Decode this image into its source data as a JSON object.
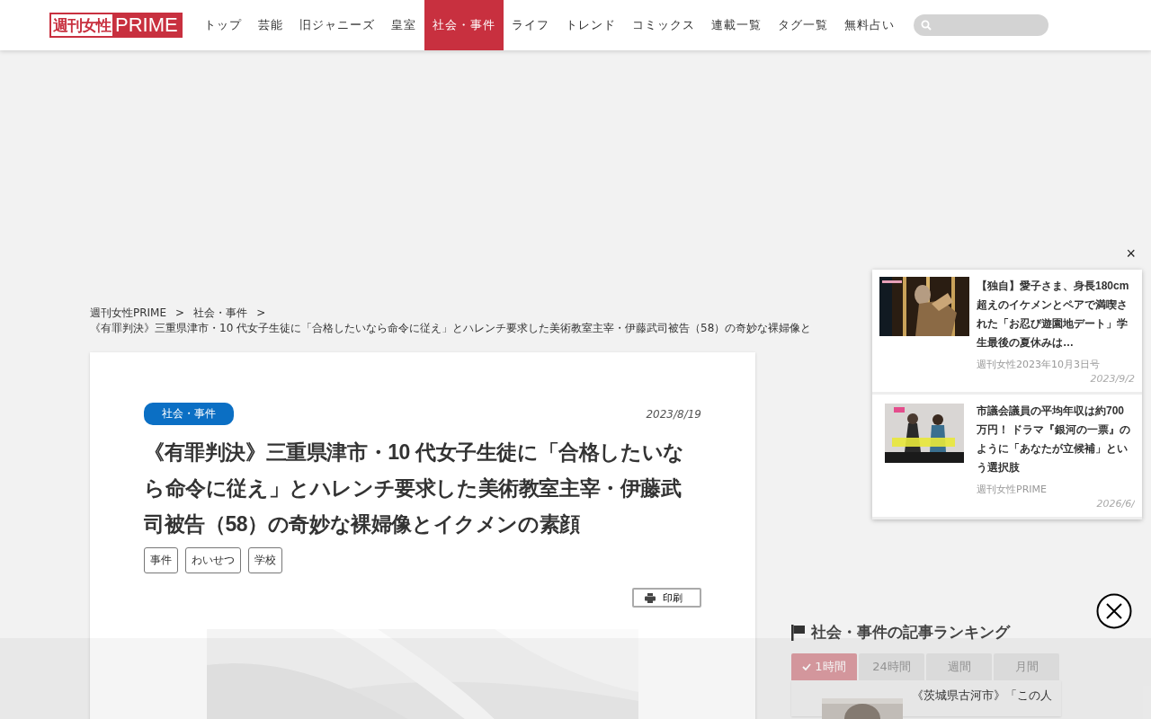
{
  "header": {
    "logo": {
      "part1": "週刊女性",
      "part2": "PRIME"
    },
    "nav": [
      {
        "label": "トップ",
        "selected": false
      },
      {
        "label": "芸能",
        "selected": false
      },
      {
        "label": "旧ジャニーズ",
        "selected": false
      },
      {
        "label": "皇室",
        "selected": false
      },
      {
        "label": "社会・事件",
        "selected": true
      },
      {
        "label": "ライフ",
        "selected": false
      },
      {
        "label": "トレンド",
        "selected": false
      },
      {
        "label": "コミックス",
        "selected": false
      },
      {
        "label": "連載一覧",
        "selected": false
      },
      {
        "label": "タグ一覧",
        "selected": false
      },
      {
        "label": "無料占い",
        "selected": false
      }
    ]
  },
  "breadcrumb": {
    "items": [
      "週刊女性PRIME",
      "社会・事件"
    ],
    "separator": ">",
    "current": "《有罪判決》三重県津市・10 代女子生徒に「合格したいなら命令に従え」とハレンチ要求した美術教室主宰・伊藤武司被告（58）の奇妙な裸婦像と"
  },
  "article": {
    "category": "社会・事件",
    "date": "2023/8/19",
    "title": "《有罪判決》三重県津市・10 代女子生徒に「合格したいなら命令に従え」とハレンチ要求した美術教室主宰・伊藤武司被告（58）の奇妙な裸婦像とイクメンの素顔",
    "tags": [
      "事件",
      "わいせつ",
      "学校"
    ],
    "print_button": "印刷",
    "image": {
      "kind": "picture"
    }
  },
  "popup": {
    "close": "×",
    "items": [
      {
        "title": "【独自】愛子さま、身長180cm超えのイケメンとペアで満喫された「お忍び遊園地デート」学生最後の夏休みは…",
        "source": "週刊女性2023年10月3日号",
        "date": "2023/9/2"
      },
      {
        "title": "市議会議員の平均年収は約700万円！ ドラマ『銀河の一票』のように「あなたが立候補」という選択肢",
        "source": "週刊女性PRIME",
        "date": "2026/6/"
      }
    ]
  },
  "ranking": {
    "heading": "社会・事件の記事ランキング",
    "tabs": [
      {
        "label": "1時間",
        "selected": true
      },
      {
        "label": "24時間",
        "selected": false
      },
      {
        "label": "週間",
        "selected": false
      },
      {
        "label": "月間",
        "selected": false
      }
    ],
    "items": [
      {
        "title": "《茨城県古河市》「この人"
      }
    ]
  }
}
